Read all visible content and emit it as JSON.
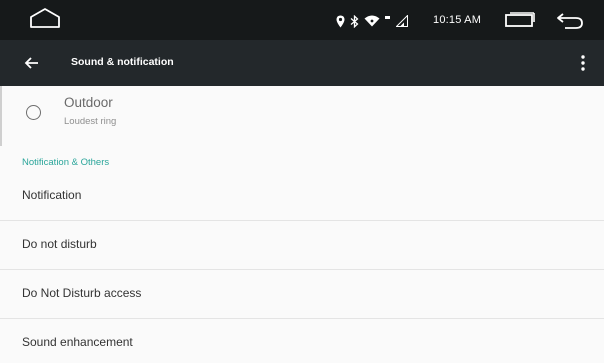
{
  "status_bar": {
    "time": "10:15 AM",
    "icons": [
      "home-icon",
      "location-icon",
      "bluetooth-icon",
      "wifi-icon",
      "signal-icon",
      "recents-icon",
      "back-icon"
    ]
  },
  "app_bar": {
    "title": "Sound & notification",
    "back_icon": "arrow-left-icon",
    "menu_icon": "more-vert-icon"
  },
  "ringer_option": {
    "title": "Outdoor",
    "subtitle": "Loudest ring",
    "selected": false
  },
  "section": {
    "header": "Notification & Others"
  },
  "items": [
    {
      "label": "Notification"
    },
    {
      "label": "Do not disturb"
    },
    {
      "label": "Do Not Disturb access"
    },
    {
      "label": "Sound enhancement"
    }
  ],
  "colors": {
    "status_bar": "#16191a",
    "app_bar": "#23282b",
    "accent": "#2aa59a",
    "background": "#fafafa"
  }
}
